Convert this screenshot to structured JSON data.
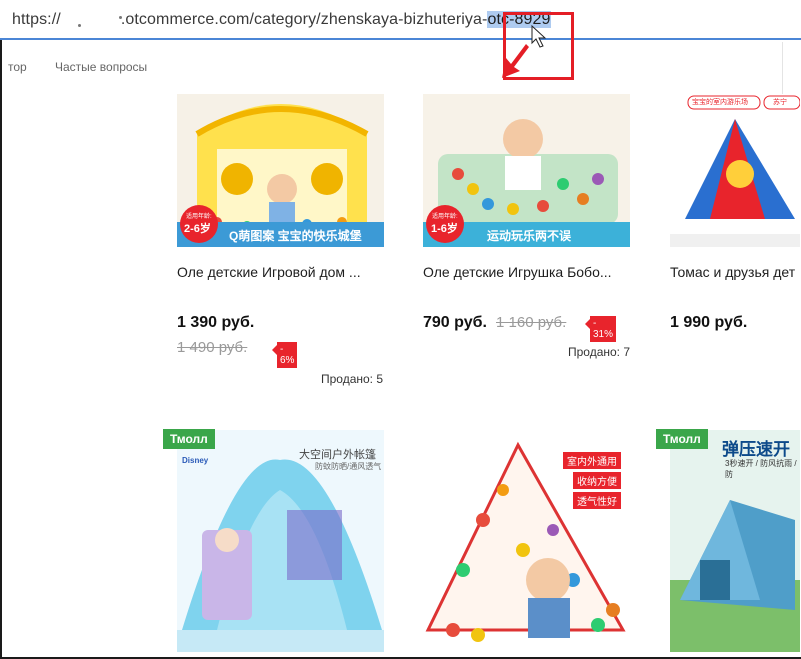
{
  "url": {
    "prefix": "https://",
    "domain": ".otcommerce.com/category/zhenskaya-bizhuteriya-",
    "selected": "otc-8929"
  },
  "nav": {
    "item_cut": "тор",
    "faq": "Частые вопросы"
  },
  "products": [
    {
      "name": "Оле детские Игровой дом ...",
      "price": "1 390 руб.",
      "old_price": "1 490 руб.",
      "discount": "- 6%",
      "sold": "Продано: 5",
      "age_badge_top": "适用年龄:",
      "age_badge": "2-6岁",
      "banner": "Q萌图案 宝宝的快乐城堡"
    },
    {
      "name": "Оле детские Игрушка Бобо...",
      "price": "790 руб.",
      "old_price": "1 160 руб.",
      "discount": "- 31%",
      "sold": "Продано: 7",
      "age_badge_top": "适用年龄:",
      "age_badge": "1-6岁",
      "banner": "运动玩乐两不误"
    },
    {
      "name": "Томас и друзья дет",
      "price": "1 990 руб.",
      "tag1": "宝宝的室内游乐场",
      "tag2": "苏宁"
    },
    {
      "tmall": "Тмолл",
      "title": "大空间户外帐篷",
      "subtitle": "防蚊防晒/通风透气",
      "brand": "Disney"
    },
    {
      "tags": [
        "室内外通用",
        "收纳方便",
        "透气性好"
      ]
    },
    {
      "tmall": "Тмолл",
      "title": "弹压速开",
      "subtitle": "3秒速开 / 防风抗雨 / 防"
    }
  ],
  "colors": {
    "accent_red": "#e41e26",
    "tmall_green": "#3aa64a",
    "discount_red": "#e8242c",
    "url_selection": "#aecbf0"
  }
}
